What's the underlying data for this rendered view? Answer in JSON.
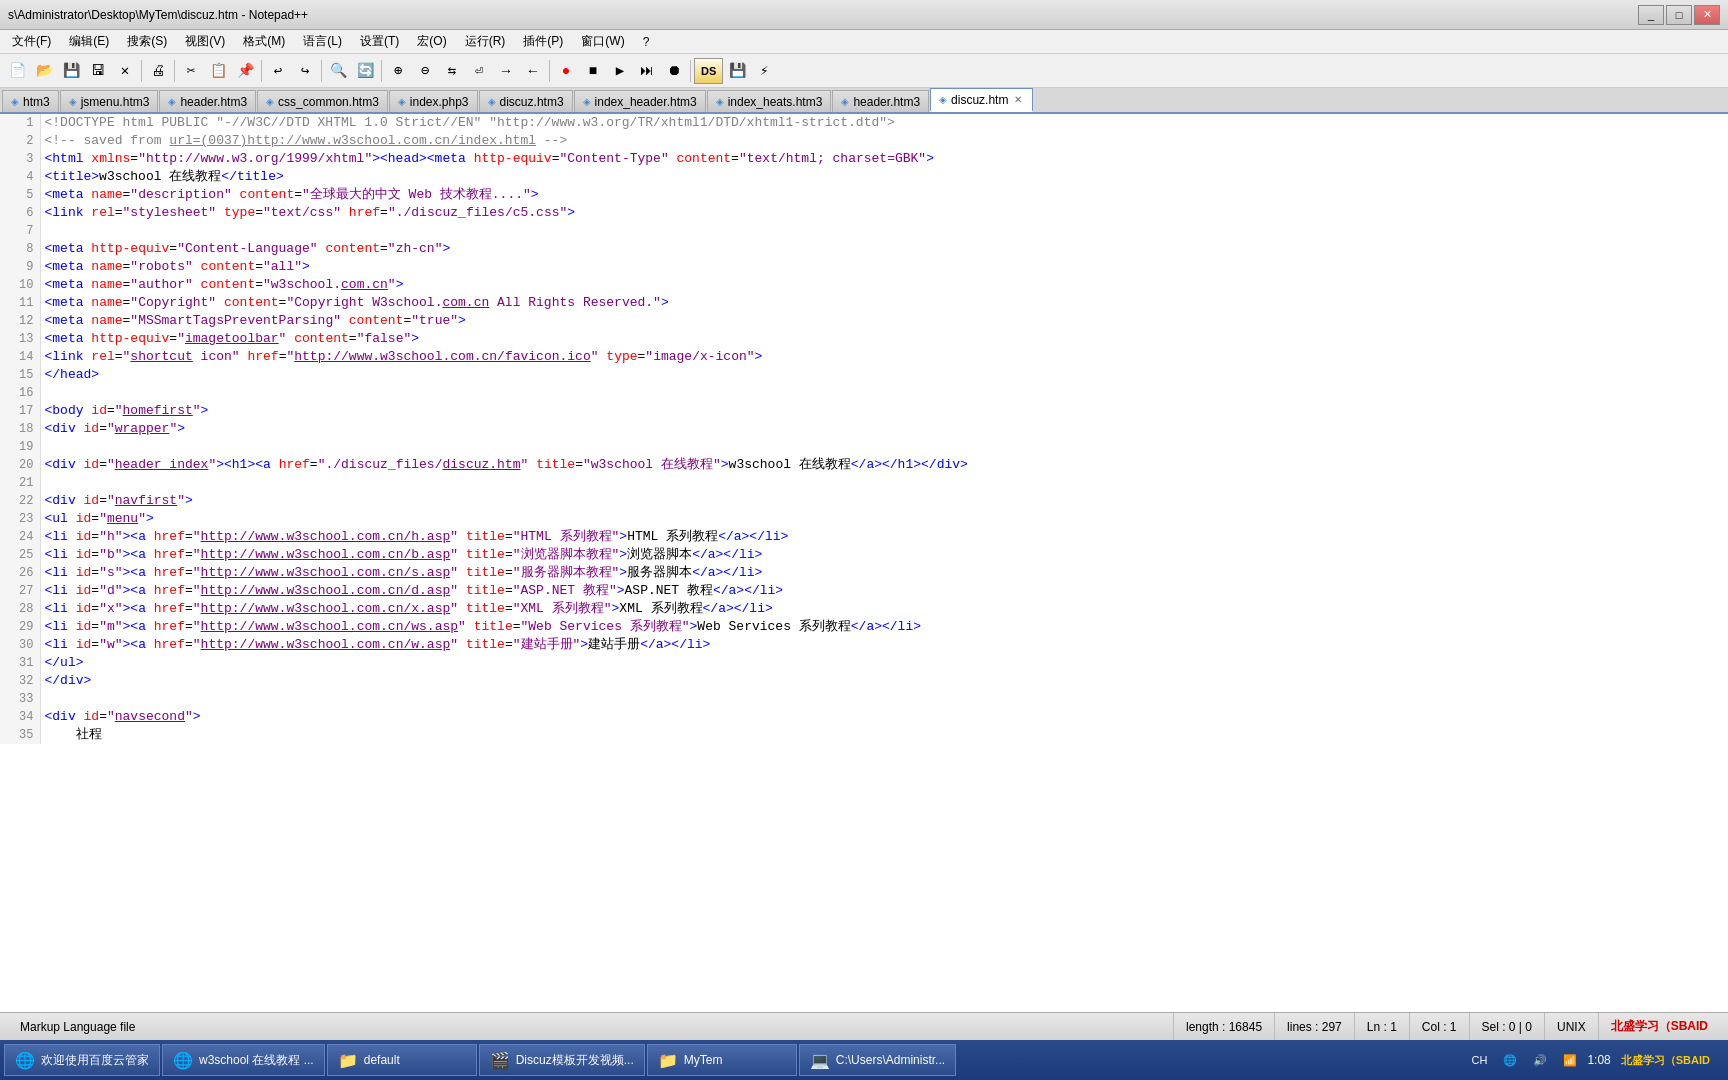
{
  "window": {
    "title": "s\\Administrator\\Desktop\\MyTem\\discuz.htm - Notepad++",
    "controls": [
      "_",
      "□",
      "✕"
    ]
  },
  "menubar": {
    "items": [
      "文件(F)",
      "编辑(E)",
      "搜索(S)",
      "视图(V)",
      "格式(M)",
      "语言(L)",
      "设置(T)",
      "宏(O)",
      "运行(R)",
      "插件(P)",
      "窗口(W)",
      "?"
    ]
  },
  "tabs": [
    {
      "label": "htm3",
      "active": false,
      "closable": false
    },
    {
      "label": "jsmenu.htm3",
      "active": false,
      "closable": false
    },
    {
      "label": "header.htm3",
      "active": false,
      "closable": false
    },
    {
      "label": "css_common.htm3",
      "active": false,
      "closable": false
    },
    {
      "label": "index.php3",
      "active": false,
      "closable": false
    },
    {
      "label": "discuz.htm3",
      "active": false,
      "closable": false
    },
    {
      "label": "index_header.htm3",
      "active": false,
      "closable": false
    },
    {
      "label": "index_heats.htm3",
      "active": false,
      "closable": false
    },
    {
      "label": "header.htm3",
      "active": false,
      "closable": false
    },
    {
      "label": "discuz.htm",
      "active": true,
      "closable": true
    }
  ],
  "statusbar": {
    "file_type": "Markup Language file",
    "length": "length : 16845",
    "lines": "lines : 297",
    "ln": "Ln : 1",
    "col": "Col : 1",
    "sel": "Sel : 0 | 0",
    "unix": "UNIX",
    "brand": "北盛学习（SBAID"
  },
  "taskbar": {
    "items": [
      {
        "icon": "🌐",
        "label": "欢迎使用百度云管家"
      },
      {
        "icon": "🌐",
        "label": "w3school 在线教程 ..."
      },
      {
        "icon": "📁",
        "label": "default"
      },
      {
        "icon": "🎬",
        "label": "Discuz模板开发视频..."
      },
      {
        "icon": "📁",
        "label": "MyTem"
      },
      {
        "icon": "💻",
        "label": "C:\\Users\\Administr..."
      }
    ],
    "tray": [
      "CH",
      "🔊",
      "🌐",
      "📅"
    ],
    "time": "1:08",
    "extras": [
      "北盛学习（SBAID"
    ]
  }
}
